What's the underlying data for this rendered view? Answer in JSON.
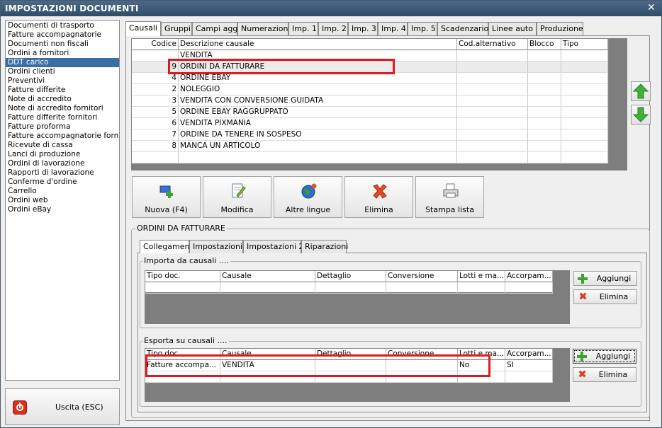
{
  "window": {
    "title": "IMPOSTAZIONI DOCUMENTI",
    "close_glyph": "✕"
  },
  "doc_list": {
    "selected_index": 4,
    "items": [
      "Documenti di trasporto",
      "Fatture accompagnatorie",
      "Documenti non fiscali",
      "Ordini a fornitori",
      "DDT carico",
      "Ordini clienti",
      "Preventivi",
      "Fatture differite",
      "Note di accredito",
      "Note di accredito fornitori",
      "Fatture differite fornitori",
      "Fatture proforma",
      "Fatture accompagnatorie fornito",
      "Ricevute di cassa",
      "Lanci di produzione",
      "Ordini di lavorazione",
      "Rapporti di lavorazione",
      "Conferme d'ordine",
      "Carrello",
      "Ordini web",
      "Ordini eBay"
    ]
  },
  "exit_button": {
    "label": "Uscita (ESC)",
    "icon": "power-icon"
  },
  "tabs": [
    "Causali",
    "Gruppi",
    "Campi agg.",
    "Numerazioni",
    "Imp. 1",
    "Imp. 2",
    "Imp. 3",
    "Imp. 4",
    "Imp. 5",
    "Scadenzario",
    "Linee auto",
    "Produzione"
  ],
  "causali_grid": {
    "columns": [
      "Codice",
      "Descrizione causale",
      "Cod.alternativo",
      "Blocco",
      "Tipo"
    ],
    "rows": [
      {
        "codice": "",
        "descrizione": "VENDITA"
      },
      {
        "codice": "9",
        "descrizione": "ORDINI DA FATTURARE"
      },
      {
        "codice": "4",
        "descrizione": "ORDINE EBAY"
      },
      {
        "codice": "2",
        "descrizione": "NOLEGGIO"
      },
      {
        "codice": "3",
        "descrizione": "VENDITA CON CONVERSIONE GUIDATA"
      },
      {
        "codice": "5",
        "descrizione": "ORDINE EBAY RAGGRUPPATO"
      },
      {
        "codice": "6",
        "descrizione": "VENDITA PIXMANIA"
      },
      {
        "codice": "7",
        "descrizione": "ORDINE DA TENERE IN SOSPESO"
      },
      {
        "codice": "8",
        "descrizione": "MANCA UN ARTICOLO"
      }
    ],
    "selected_index": 1
  },
  "move": {
    "up_icon": "arrow-up-icon",
    "down_icon": "arrow-down-icon"
  },
  "toolbar": {
    "new_label": "Nuova (F4)",
    "edit_label": "Modifica",
    "languages_label": "Altre lingue",
    "delete_label": "Elimina",
    "print_label": "Stampa lista"
  },
  "detail": {
    "title": "ORDINI DA FATTURARE",
    "subtabs": [
      "Collegamenti",
      "Impostazioni",
      "Impostazioni 2",
      "Riparazioni"
    ],
    "import_section": {
      "title": "Importa da causali ....",
      "columns": [
        "Tipo doc.",
        "Causale",
        "Dettaglio",
        "Conversione",
        "Lotti e ma...",
        "Accorpam..."
      ],
      "add_label": "Aggiungi",
      "delete_label": "Elimina"
    },
    "export_section": {
      "title": "Esporta su causali ....",
      "columns": [
        "Tipo doc.",
        "Causale",
        "Dettaglio",
        "Conversione",
        "Lotti e ma...",
        "Accorpam..."
      ],
      "rows": [
        {
          "tipo_doc": "Fatture accompa...",
          "causale": "VENDITA",
          "dettaglio": "",
          "conversione": "",
          "lotti": "No",
          "accorpam": "SI"
        }
      ],
      "add_label": "Aggiungi",
      "delete_label": "Elimina"
    }
  },
  "colors": {
    "title_bar": "#2f4c69",
    "selection": "#3a6ea5",
    "highlight_box": "#e0191f"
  }
}
